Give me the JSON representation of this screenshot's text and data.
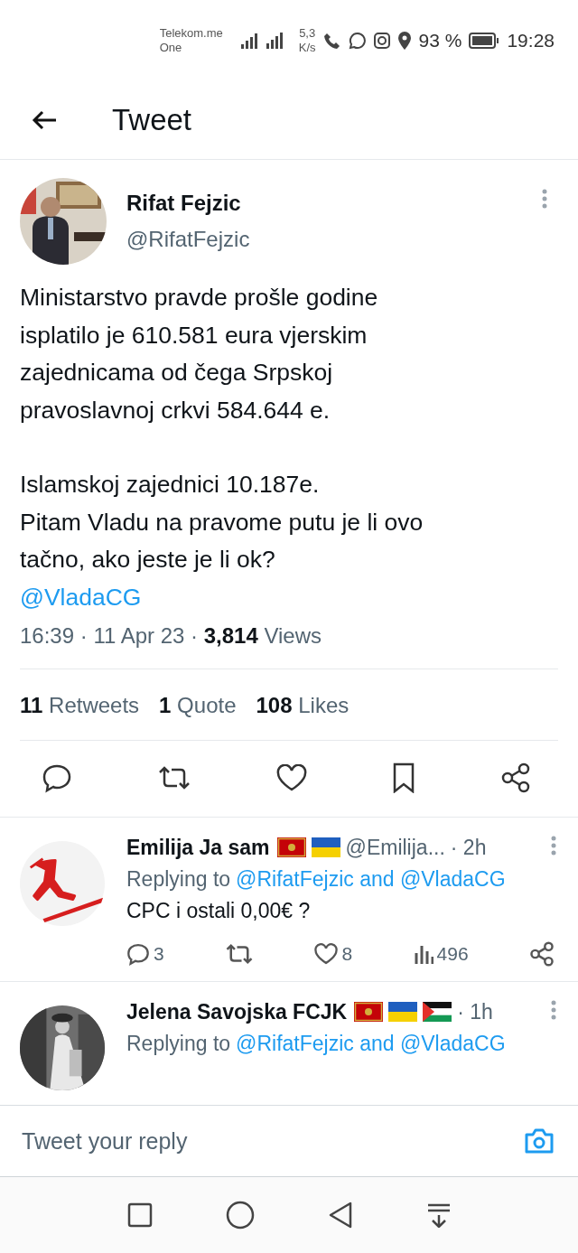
{
  "status_bar": {
    "carrier": "Telekom.me",
    "carrier_2": "One",
    "speed": "5,3",
    "speed_unit": "K/s",
    "battery": "93 %",
    "time": "19:28"
  },
  "header": {
    "title": "Tweet"
  },
  "tweet": {
    "name": "Rifat Fejzic",
    "handle": "@RifatFejzic",
    "paragraphs": [
      "Ministarstvo pravde prošle  godine\nisplatilo je 610.581 eura vjerskim\nzajednicama od čega Srpskoj\npravoslavnoj crkvi 584.644 e.",
      "Islamskoj zajednici 10.187e.\nPitam Vladu na pravome putu je li ovo\ntačno, ako jeste je li ok?"
    ],
    "mention": "@VladaCG",
    "meta": "16:39 · 11 Apr 23 · **3,814** Views",
    "stats": [
      "**11** Retweets",
      "**1** Quote",
      "**108** Likes"
    ]
  },
  "replies": [
    {
      "avatar": {
        "kind": "logo"
      },
      "name": "Emilija Ja sam",
      "flags": [
        {
          "kind": "montenegro"
        },
        {
          "kind": "ukraine"
        }
      ],
      "handle": "@Emilija...",
      "time": "· 2h",
      "replying": "Replying to",
      "to": "@RifatFejzic and @VladaCG",
      "text": "CPC i ostali 0,00€ ?",
      "replies_count": "3",
      "likes": "8",
      "views": "496"
    },
    {
      "name": "Jelena Savojska FCJK",
      "flags": [
        {
          "kind": "montenegro"
        },
        {
          "kind": "ukraine"
        },
        {
          "kind": "palestine"
        }
      ],
      "time": "· 1h",
      "replying": "Replying to",
      "to": "@RifatFejzic and @VladaCG"
    }
  ],
  "composer": {
    "placeholder": "Tweet your reply"
  }
}
